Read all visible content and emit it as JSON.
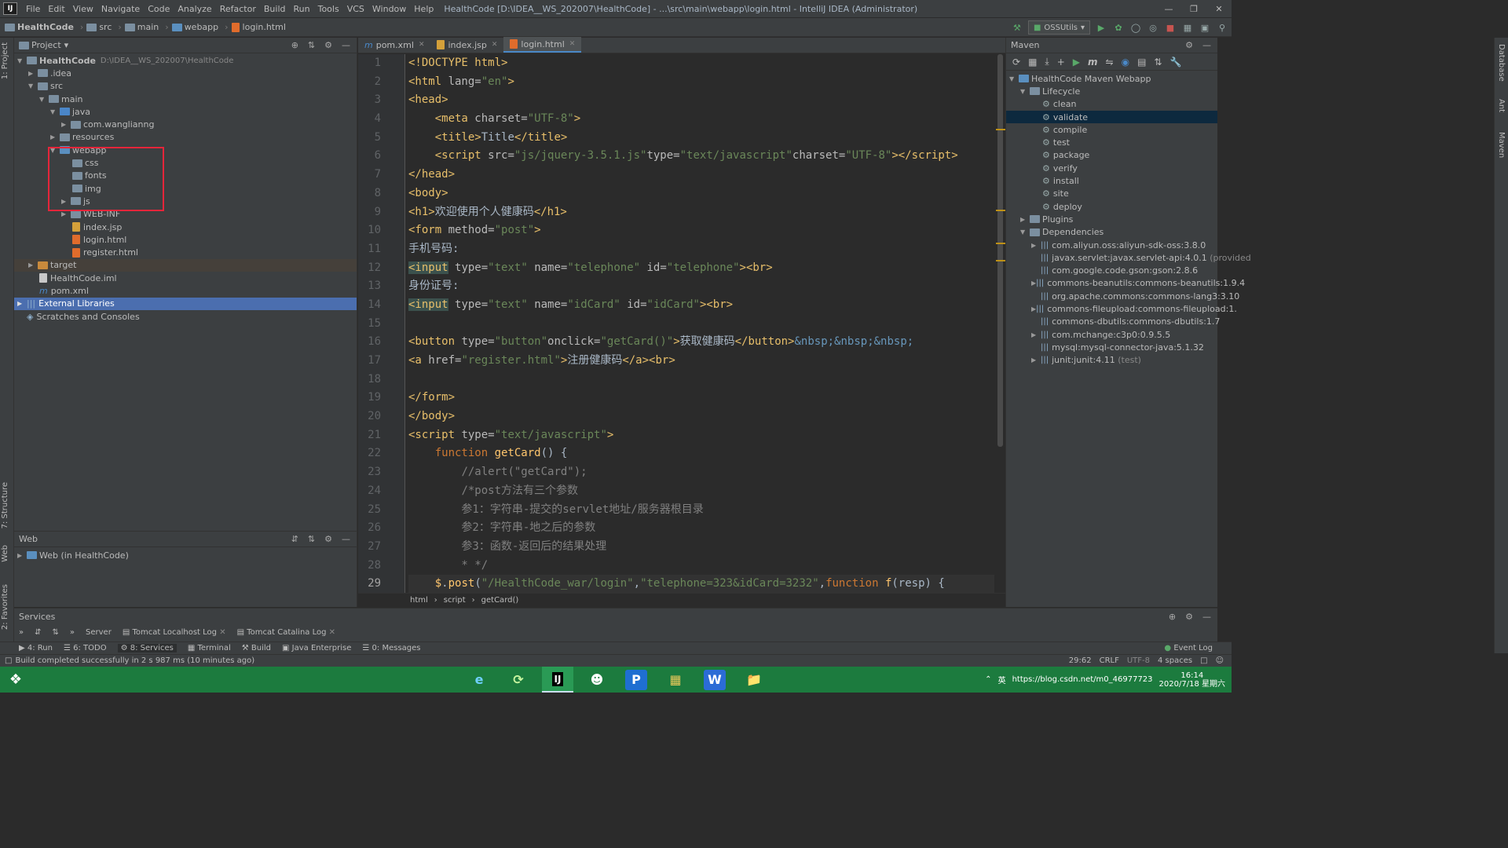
{
  "menubar": {
    "items": [
      "File",
      "Edit",
      "View",
      "Navigate",
      "Code",
      "Analyze",
      "Refactor",
      "Build",
      "Run",
      "Tools",
      "VCS",
      "Window",
      "Help"
    ],
    "window_title": "HealthCode [D:\\IDEA__WS_202007\\HealthCode] - ...\\src\\main\\webapp\\login.html - IntelliJ IDEA (Administrator)"
  },
  "breadcrumb": [
    "HealthCode",
    "src",
    "main",
    "webapp",
    "login.html"
  ],
  "run_config": "OSSUtils",
  "project_panel": {
    "title": "Project",
    "tree": [
      {
        "label": "HealthCode",
        "dim": "D:\\IDEA__WS_202007\\HealthCode"
      },
      {
        "label": ".idea"
      },
      {
        "label": "src"
      },
      {
        "label": "main"
      },
      {
        "label": "java"
      },
      {
        "label": "com.wanglianng"
      },
      {
        "label": "resources"
      },
      {
        "label": "webapp"
      },
      {
        "label": "css"
      },
      {
        "label": "fonts"
      },
      {
        "label": "img"
      },
      {
        "label": "js"
      },
      {
        "label": "WEB-INF"
      },
      {
        "label": "index.jsp"
      },
      {
        "label": "login.html"
      },
      {
        "label": "register.html"
      },
      {
        "label": "target"
      },
      {
        "label": "HealthCode.iml"
      },
      {
        "label": "pom.xml"
      },
      {
        "label": "External Libraries"
      },
      {
        "label": "Scratches and Consoles"
      }
    ]
  },
  "web_panel": {
    "title": "Web",
    "item": "Web (in HealthCode)"
  },
  "editor": {
    "tabs": [
      "pom.xml",
      "index.jsp",
      "login.html"
    ],
    "line_numbers": [
      "1",
      "2",
      "3",
      "4",
      "5",
      "6",
      "7",
      "8",
      "9",
      "10",
      "11",
      "12",
      "13",
      "14",
      "15",
      "16",
      "17",
      "18",
      "19",
      "20",
      "21",
      "22",
      "23",
      "24",
      "25",
      "26",
      "27",
      "28",
      "29"
    ],
    "breadcrumb": [
      "html",
      "script",
      "getCard()"
    ]
  },
  "maven": {
    "title": "Maven",
    "root": "HealthCode Maven Webapp",
    "lifecycle_label": "Lifecycle",
    "lifecycle": [
      "clean",
      "validate",
      "compile",
      "test",
      "package",
      "verify",
      "install",
      "site",
      "deploy"
    ],
    "plugins_label": "Plugins",
    "dependencies_label": "Dependencies",
    "dependencies": [
      {
        "name": "com.aliyun.oss:aliyun-sdk-oss:3.8.0",
        "note": ""
      },
      {
        "name": "javax.servlet:javax.servlet-api:4.0.1",
        "note": "(provided"
      },
      {
        "name": "com.google.code.gson:gson:2.8.6",
        "note": ""
      },
      {
        "name": "commons-beanutils:commons-beanutils:1.9.4",
        "note": ""
      },
      {
        "name": "org.apache.commons:commons-lang3:3.10",
        "note": ""
      },
      {
        "name": "commons-fileupload:commons-fileupload:1.",
        "note": ""
      },
      {
        "name": "commons-dbutils:commons-dbutils:1.7",
        "note": ""
      },
      {
        "name": "com.mchange:c3p0:0.9.5.5",
        "note": ""
      },
      {
        "name": "mysql:mysql-connector-java:5.1.32",
        "note": ""
      },
      {
        "name": "junit:junit:4.11",
        "note": "(test)"
      }
    ]
  },
  "services": {
    "title": "Services",
    "tabs": [
      "Server",
      "Tomcat Localhost Log",
      "Tomcat Catalina Log"
    ]
  },
  "toolwindows": [
    "4: Run",
    "6: TODO",
    "8: Services",
    "Terminal",
    "Build",
    "Java Enterprise",
    "0: Messages"
  ],
  "event_log": "Event Log",
  "status": {
    "message": "Build completed successfully in 2 s 987 ms (10 minutes ago)",
    "position": "29:62",
    "line_sep": "CRLF",
    "encoding": "UTF-8",
    "indent": "4 spaces"
  },
  "left_stripe": [
    "1: Project",
    "7: Structure",
    "Web",
    "2: Favorites"
  ],
  "right_stripe": [
    "Database",
    "Ant",
    "Maven"
  ],
  "taskbar": {
    "time": "16:14",
    "date": "2020/7/18 星期六",
    "watermark": "https://blog.csdn.net/m0_46977723",
    "ime": "英"
  }
}
